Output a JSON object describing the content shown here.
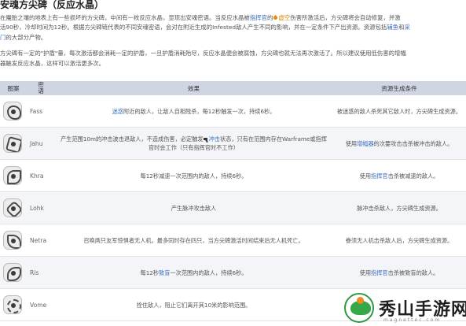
{
  "section_title": "安魂方尖碑（反应水晶）",
  "intro": {
    "line1_a": "在魔胎之壤的地表上有一些损坏的方尖碑，中间有一枚反应水晶，显现出安魂密语。当反应水晶被",
    "line1_link": "指挥官",
    "line1_b": "的",
    "line1_orange": "虚空",
    "line1_c": "伤害所激活后，方尖碑将会自动修复，并激",
    "line2_a": "活90秒，冷却时间为12秒。根据方尖碑链代表的不同安魂密语，会对在附近生成的Infested敌人产生不同的影响，并在一定条件下产出资源。资源包括",
    "line2_link": "辅鱼",
    "line2_b": "和",
    "line2_link2": "采",
    "line3_link": "门",
    "line3_b": "的大部分产物。",
    "line4": "方尖碑有一定的\"护盾\"量，每次激活都会消耗一定的护盾，一旦护盾消耗殆尽，反应水晶便会被腐蚀，方尖碑也就无法再次激活了。所以建议使用低伤害的增幅",
    "line5": "器触发反应水晶，这样可以激活更多次。"
  },
  "table": {
    "headers": {
      "icon": "图案",
      "name": "密语",
      "effect": "效果",
      "condition": "资源生成条件"
    },
    "rows": [
      {
        "icon": "fass-glyph-icon",
        "name": "Fass",
        "effect_pre": "",
        "effect_link": "迷惑",
        "effect_post": "附近的敌人，让敌人自相残杀，每12秒触发一次，持续6秒。",
        "condition": "被迷惑的敌人杀死其它敌人时，方尖碑生成资源。"
      },
      {
        "icon": "jahu-glyph-icon",
        "name": "Jahu",
        "effect_pre": "产生范围10m的冲击波击退敌人，不造成伤害，必定触发",
        "effect_link": "冲击",
        "effect_post": "状态，只有在范围内存在Warframe或指挥官时会工作（只有指挥官时不工作）",
        "condition_link": "增幅器",
        "condition_pre": "使用",
        "condition": "的次要攻击击杀被冲击的敌人。"
      },
      {
        "icon": "khra-glyph-icon",
        "name": "Khra",
        "effect_pre": "",
        "effect_link": "",
        "effect_post": "每12秒减速一次范围内的敌人，持续6秒。",
        "condition_pre": "使用",
        "condition_link": "指挥官",
        "condition": "击杀被减速的敌人。"
      },
      {
        "icon": "lohk-glyph-icon",
        "name": "Lohk",
        "effect_pre": "",
        "effect_link": "",
        "effect_post": "产生脉冲攻击敌人",
        "condition": "脉冲击杀敌人，方尖碑生成资源。"
      },
      {
        "icon": "netra-glyph-icon",
        "name": "Netra",
        "effect_pre": "",
        "effect_link": "",
        "effect_post": "召唤两只友军惊惧者无人机，最多同时存在四只，当方尖碑激活时间结束后无人机死亡。",
        "condition": "眷须无人机击杀敌人后，方尖碑生成资源。"
      },
      {
        "icon": "ris-glyph-icon",
        "name": "Ris",
        "effect_pre": "每12秒",
        "effect_link": "致盲",
        "effect_post": "一次范围内的敌人，持续6秒。",
        "condition_pre": "使用",
        "condition_link": "指挥官",
        "condition": "击杀被致盲的敌人。"
      },
      {
        "icon": "vome-glyph-icon",
        "name": "Vome",
        "effect_pre": "",
        "effect_link": "",
        "effect_post": "拴住敌人，阻止它们离开其10米的影响范围。",
        "condition": ""
      }
    ]
  },
  "watermark": {
    "brand": "秀山手游网",
    "url": "magnettec.com"
  },
  "colors": {
    "header_bg": "#cfd6e2",
    "link": "#3b6fc2",
    "accent_orange": "#d8890e",
    "watermark_green": "#36a84a"
  }
}
